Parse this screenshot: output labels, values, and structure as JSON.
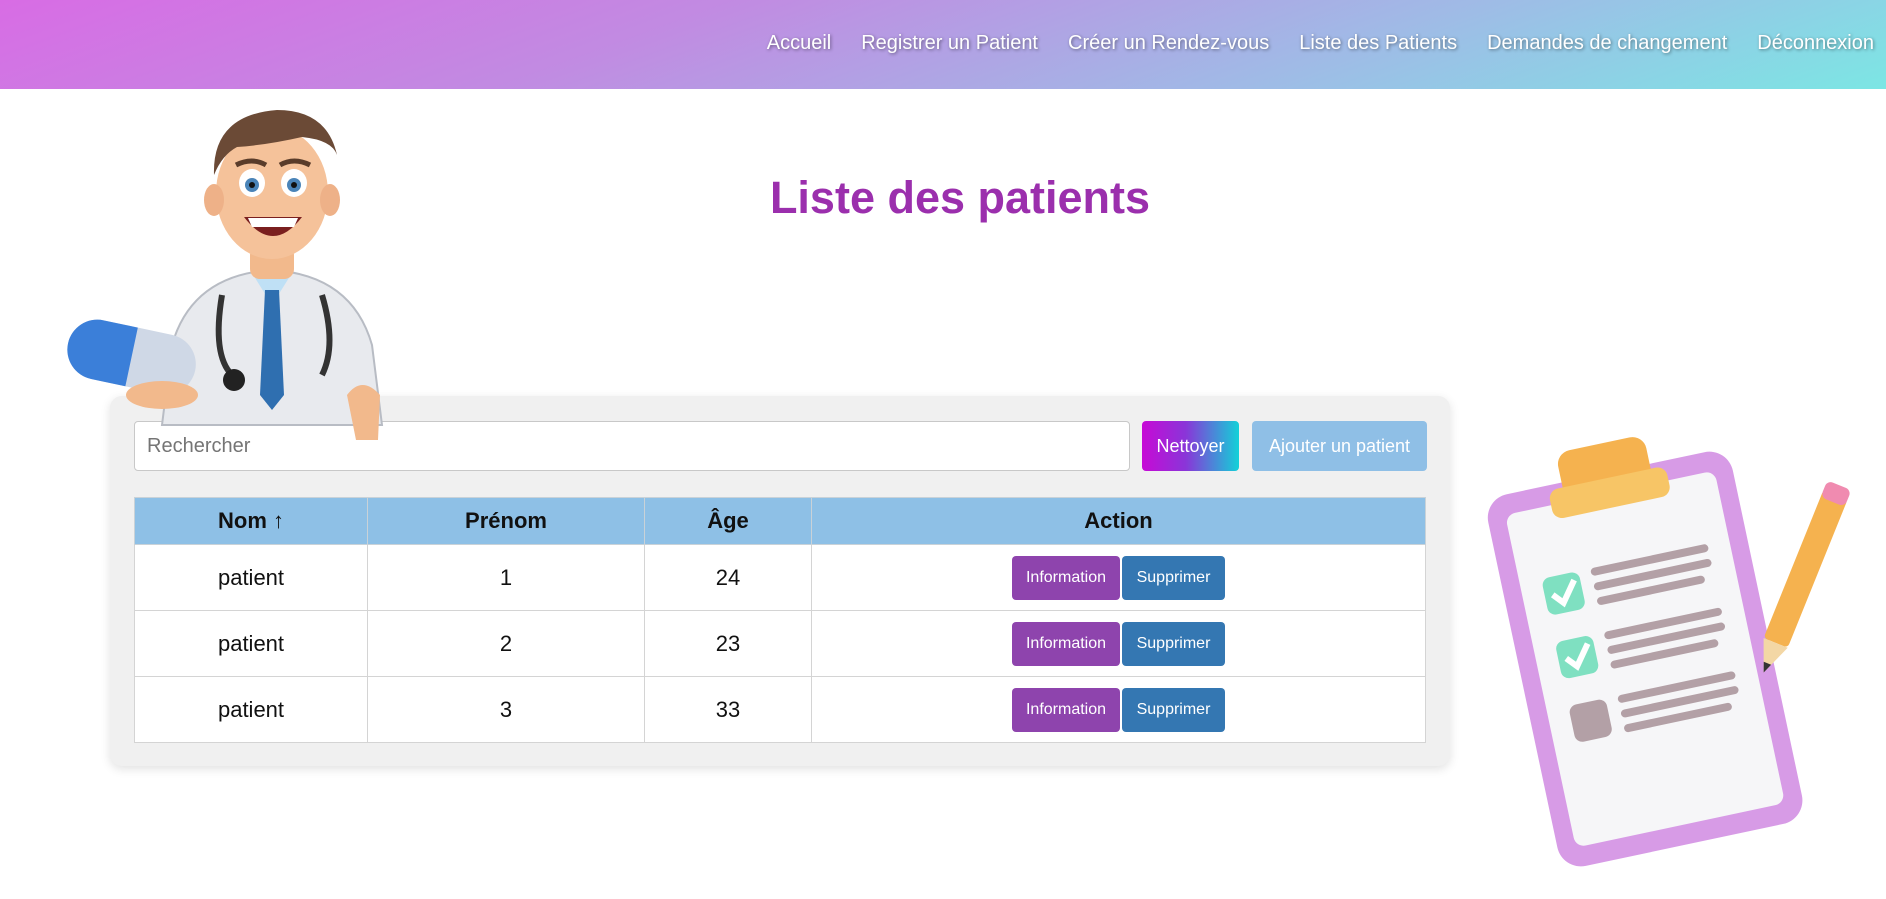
{
  "nav": {
    "items": [
      {
        "label": "Accueil"
      },
      {
        "label": "Registrer un Patient"
      },
      {
        "label": "Créer un Rendez-vous"
      },
      {
        "label": "Liste des Patients"
      },
      {
        "label": "Demandes de changement"
      },
      {
        "label": "Déconnexion"
      }
    ]
  },
  "page": {
    "title": "Liste des patients"
  },
  "search": {
    "placeholder": "Rechercher",
    "value": ""
  },
  "buttons": {
    "clear": "Nettoyer",
    "add": "Ajouter un patient"
  },
  "table": {
    "headers": {
      "nom": "Nom ↑",
      "prenom": "Prénom",
      "age": "Âge",
      "action": "Action"
    },
    "rows": [
      {
        "nom": "patient",
        "prenom": "1",
        "age": "24",
        "info": "Information",
        "delete": "Supprimer"
      },
      {
        "nom": "patient",
        "prenom": "2",
        "age": "23",
        "info": "Information",
        "delete": "Supprimer"
      },
      {
        "nom": "patient",
        "prenom": "3",
        "age": "33",
        "info": "Information",
        "delete": "Supprimer"
      }
    ]
  },
  "illustrations": {
    "left": "doctor-cartoon-icon",
    "right": "clipboard-checklist-icon"
  },
  "colors": {
    "title": "#9b2fad",
    "header_bg": "#8ec0e6",
    "info_button": "#8e44ad",
    "delete_button": "#3477b2",
    "add_button": "#8fbfe6"
  }
}
